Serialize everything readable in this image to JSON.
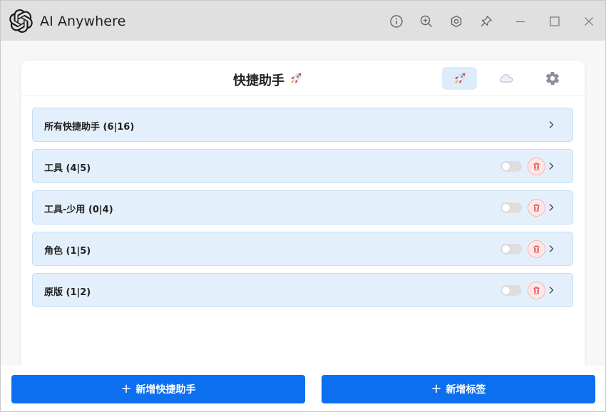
{
  "window": {
    "title": "AI Anywhere",
    "accent": "#0b6ff0"
  },
  "titlebar_icons": [
    "info-icon",
    "zoom-in-icon",
    "hexagon-settings-icon",
    "pin-icon",
    "minimize-icon",
    "maximize-icon",
    "close-icon"
  ],
  "panel": {
    "title": "快捷助手",
    "tabs": [
      {
        "icon": "rocket-icon",
        "active": true
      },
      {
        "icon": "cloud-icon",
        "active": false
      },
      {
        "icon": "gear-icon",
        "active": false
      }
    ]
  },
  "groups": [
    {
      "label": "所有快捷助手 (6|16)",
      "toggle": false,
      "deletable": false
    },
    {
      "label": "工具 (4|5)",
      "toggle": false,
      "deletable": true
    },
    {
      "label": "工具-少用 (0|4)",
      "toggle": false,
      "deletable": true
    },
    {
      "label": "角色 (1|5)",
      "toggle": false,
      "deletable": true
    },
    {
      "label": "原版 (1|2)",
      "toggle": false,
      "deletable": true
    }
  ],
  "footer": {
    "plus": "+",
    "add_assistant_label": "新增快捷助手",
    "add_tag_label": "新增标签"
  }
}
